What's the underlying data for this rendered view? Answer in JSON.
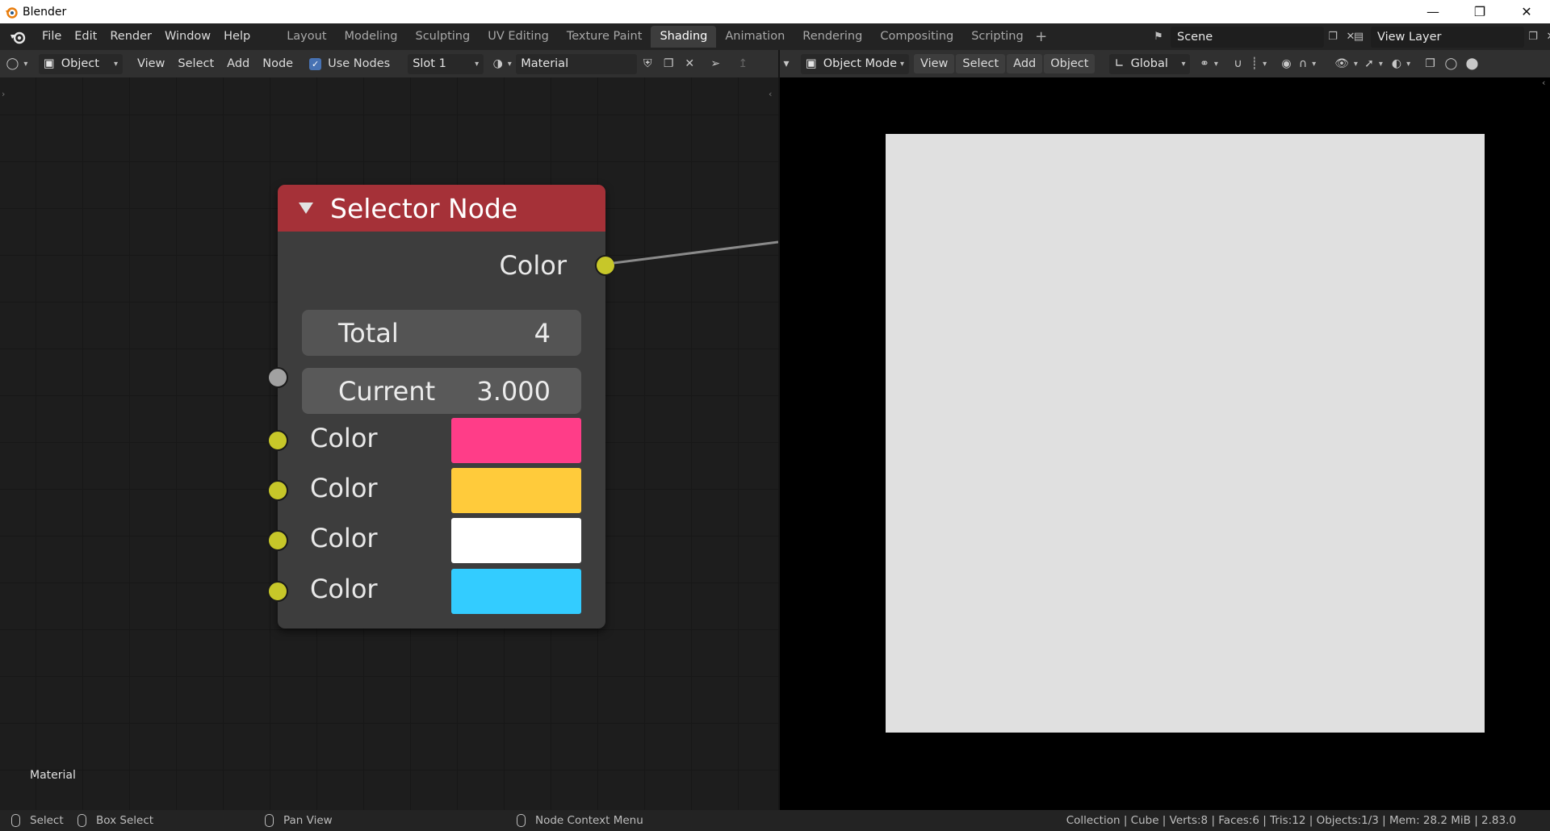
{
  "window": {
    "title": "Blender",
    "controls": [
      "minimize-icon",
      "restore-icon",
      "close-icon"
    ]
  },
  "menu": {
    "items": [
      "File",
      "Edit",
      "Render",
      "Window",
      "Help"
    ]
  },
  "workspaces": {
    "tabs": [
      "Layout",
      "Modeling",
      "Sculpting",
      "UV Editing",
      "Texture Paint",
      "Shading",
      "Animation",
      "Rendering",
      "Compositing",
      "Scripting"
    ],
    "active": "Shading",
    "add_label": "+"
  },
  "scene": {
    "name": "Scene",
    "view_layer": "View Layer"
  },
  "node_editor_header": {
    "object_dropdown": "Object",
    "menus": [
      "View",
      "Select",
      "Add",
      "Node"
    ],
    "use_nodes_label": "Use Nodes",
    "use_nodes_checked": true,
    "slot": "Slot 1",
    "material": "Material"
  },
  "viewport_header": {
    "mode": "Object Mode",
    "menus": [
      "View",
      "Select",
      "Add",
      "Object"
    ],
    "orientation": "Global"
  },
  "node": {
    "title": "Selector Node",
    "header_color": "#a53138",
    "output_label": "Color",
    "total_label": "Total",
    "total_value": "4",
    "current_label": "Current",
    "current_value": "3.000",
    "inputs": [
      {
        "label": "Color",
        "color": "#ff3d88"
      },
      {
        "label": "Color",
        "color": "#ffcb3b"
      },
      {
        "label": "Color",
        "color": "#ffffff"
      },
      {
        "label": "Color",
        "color": "#33ccff"
      }
    ]
  },
  "node_canvas": {
    "context_label": "Material"
  },
  "viewport": {
    "preview_color": "#e0e0e0"
  },
  "statusbar": {
    "select": "Select",
    "box_select": "Box Select",
    "pan_view": "Pan View",
    "context_menu": "Node Context Menu",
    "stats": "Collection | Cube | Verts:8 | Faces:6 | Tris:12 | Objects:1/3 | Mem: 28.2 MiB | 2.83.0"
  }
}
